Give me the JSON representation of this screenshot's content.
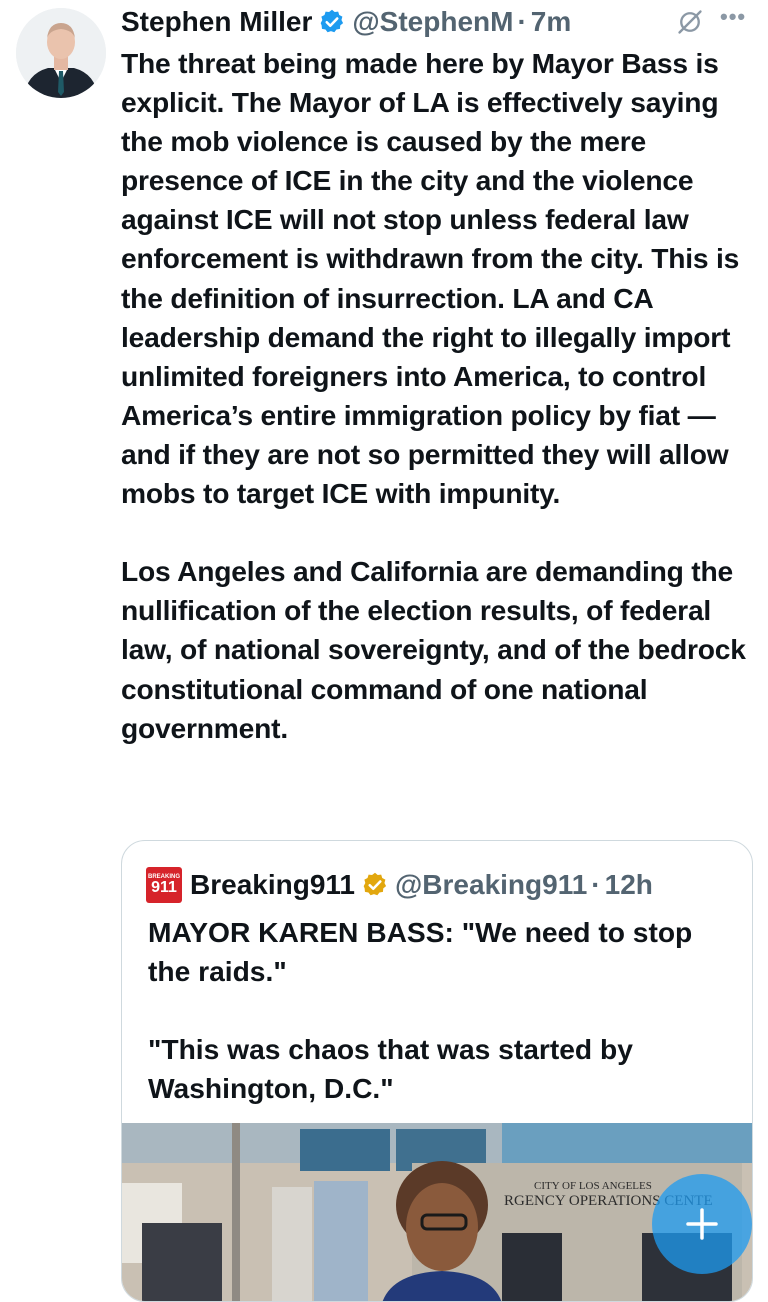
{
  "tweet": {
    "author_name": "Stephen Miller",
    "author_handle": "@StephenM",
    "separator": "·",
    "time": "7m",
    "more_icon": "more-icon",
    "text": "The threat being made here by Mayor Bass is explicit. The Mayor of LA is effectively saying the mob violence is caused by the mere presence of ICE in the city and the violence against ICE will not stop unless federal law enforcement is withdrawn from the city. This is the definition of insurrection. LA and CA leadership demand the right to illegally import unlimited foreigners into America, to control America’s entire immigration policy by fiat — and if they are not so permitted they will allow mobs to target ICE with impunity.\n\nLos Angeles and California are demanding the nullification of the election results, of federal law, of national sovereignty, and of the bedrock constitutional command of one national government."
  },
  "quote": {
    "logo_text": "911",
    "logo_small": "BREAKING",
    "author_name": "Breaking911",
    "author_handle": "@Breaking911",
    "separator": "·",
    "time": "12h",
    "text": "MAYOR KAREN BASS: \"We need to stop the raids.\"\n\n\"This was chaos that was started by Washington, D.C.\"",
    "image_sign_line1": "CITY OF LOS ANGELES",
    "image_sign_line2": "RGENCY OPERATIONS CENTE"
  },
  "colors": {
    "verified_gold": "#e2a70e",
    "verified_blue": "#1d9bf0",
    "fab": "#1d9bf0"
  }
}
